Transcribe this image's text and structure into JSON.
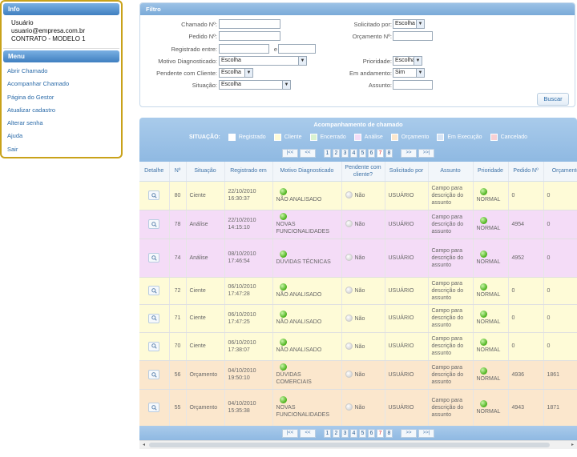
{
  "sidebar": {
    "info_title": "Info",
    "user_label": "Usuário",
    "user_email": "usuario@empresa.com.br",
    "contract": "CONTRATO - MODELO 1",
    "menu_title": "Menu",
    "menu_items": [
      "Abrir Chamado",
      "Acompanhar Chamado",
      "Página do Gestor",
      "Atualizar cadastro",
      "Alterar senha",
      "Ajuda",
      "Sair"
    ]
  },
  "filter": {
    "title": "Filtro",
    "chamado_label": "Chamado Nº:",
    "pedido_label": "Pedido Nº:",
    "registrado_label": "Registrado entre:",
    "e_label": "e",
    "motivo_label": "Motivo Diagnosticado:",
    "motivo_value": "Escolha",
    "pendente_label": "Pendente com Cliente:",
    "pendente_value": "Escolha",
    "situacao_label": "Situação:",
    "situacao_value": "Escolha",
    "solicitado_label": "Solicitado por:",
    "solicitado_value": "Escolha",
    "orcamento_label": "Orçamento Nº:",
    "prioridade_label": "Prioridade:",
    "prioridade_value": "Escolha",
    "andamento_label": "Em andamento:",
    "andamento_value": "Sim",
    "assunto_label": "Assunto:",
    "search_button": "Buscar"
  },
  "tracking": {
    "title": "Acompanhamento de chamado",
    "legend_label": "SITUAÇÃO:",
    "legend": [
      {
        "label": "Registrado",
        "color": "#ffffff"
      },
      {
        "label": "Cliente",
        "color": "#fefbd7"
      },
      {
        "label": "Encerrado",
        "color": "#d9f2d0"
      },
      {
        "label": "Análise",
        "color": "#f4dcf7"
      },
      {
        "label": "Orçamento",
        "color": "#fbe7cd"
      },
      {
        "label": "Em Execução",
        "color": "#d6e4f5"
      },
      {
        "label": "Cancelado",
        "color": "#f7d0d4"
      }
    ],
    "pager": {
      "first": "|<<",
      "prev": "<<",
      "pages": [
        "1",
        "2",
        "3",
        "4",
        "5",
        "6",
        "7",
        "8"
      ],
      "current": "7",
      "next": ">>",
      "last": ">>|"
    },
    "columns": [
      "Detalhe",
      "Nº",
      "Situação",
      "Registrado em",
      "Motivo Diagnosticado",
      "Pendente com cliente?",
      "Solicitado por",
      "Assunto",
      "Prioridade",
      "Pedido Nº",
      "Orçamento"
    ],
    "rows": [
      {
        "num": "80",
        "situacao": "Ciente",
        "data": "22/10/2010",
        "hora": "16:30:37",
        "motivo": "NÃO ANALISADO",
        "pendente": "Não",
        "solicitado": "USUÁRIO",
        "assunto": "Campo para descrição do assunto",
        "prioridade": "NORMAL",
        "pedido": "0",
        "orcamento": "0",
        "tone": "cliente"
      },
      {
        "num": "78",
        "situacao": "Análise",
        "data": "22/10/2010",
        "hora": "14:15:10",
        "motivo": "NOVAS FUNCIONALIDADES",
        "pendente": "Não",
        "solicitado": "USUÁRIO",
        "assunto": "Campo para descrição do assunto",
        "prioridade": "NORMAL",
        "pedido": "4954",
        "orcamento": "0",
        "tone": "analise"
      },
      {
        "num": "74",
        "situacao": "Análise",
        "data": "08/10/2010",
        "hora": "17:46:54",
        "motivo": "DÚVIDAS TÉCNICAS",
        "pendente": "Não",
        "solicitado": "USUÁRIO",
        "assunto": "Campo para descrição do assunto",
        "prioridade": "NORMAL",
        "pedido": "4952",
        "orcamento": "0",
        "tone": "analise"
      },
      {
        "num": "72",
        "situacao": "Ciente",
        "data": "06/10/2010",
        "hora": "17:47:28",
        "motivo": "NÃO ANALISADO",
        "pendente": "Não",
        "solicitado": "USUÁRIO",
        "assunto": "Campo para descrição do assunto",
        "prioridade": "NORMAL",
        "pedido": "0",
        "orcamento": "0",
        "tone": "cliente"
      },
      {
        "num": "71",
        "situacao": "Ciente",
        "data": "06/10/2010",
        "hora": "17:47:25",
        "motivo": "NÃO ANALISADO",
        "pendente": "Não",
        "solicitado": "USUÁRIO",
        "assunto": "Campo para descrição do assunto",
        "prioridade": "NORMAL",
        "pedido": "0",
        "orcamento": "0",
        "tone": "cliente"
      },
      {
        "num": "70",
        "situacao": "Ciente",
        "data": "06/10/2010",
        "hora": "17:38:07",
        "motivo": "NÃO ANALISADO",
        "pendente": "Não",
        "solicitado": "USUÁRIO",
        "assunto": "Campo para descrição do assunto",
        "prioridade": "NORMAL",
        "pedido": "0",
        "orcamento": "0",
        "tone": "cliente"
      },
      {
        "num": "56",
        "situacao": "Orçamento",
        "data": "04/10/2010",
        "hora": "19:50:10",
        "motivo": "DÚVIDAS COMERCIAIS",
        "pendente": "Não",
        "solicitado": "USUÁRIO",
        "assunto": "Campo para descrição do assunto",
        "prioridade": "NORMAL",
        "pedido": "4936",
        "orcamento": "1861",
        "tone": "orcamento"
      },
      {
        "num": "55",
        "situacao": "Orçamento",
        "data": "04/10/2010",
        "hora": "15:35:38",
        "motivo": "NOVAS FUNCIONALIDADES",
        "pendente": "Não",
        "solicitado": "USUÁRIO",
        "assunto": "Campo para descrição do assunto",
        "prioridade": "NORMAL",
        "pedido": "4943",
        "orcamento": "1871",
        "tone": "orcamento"
      }
    ]
  }
}
